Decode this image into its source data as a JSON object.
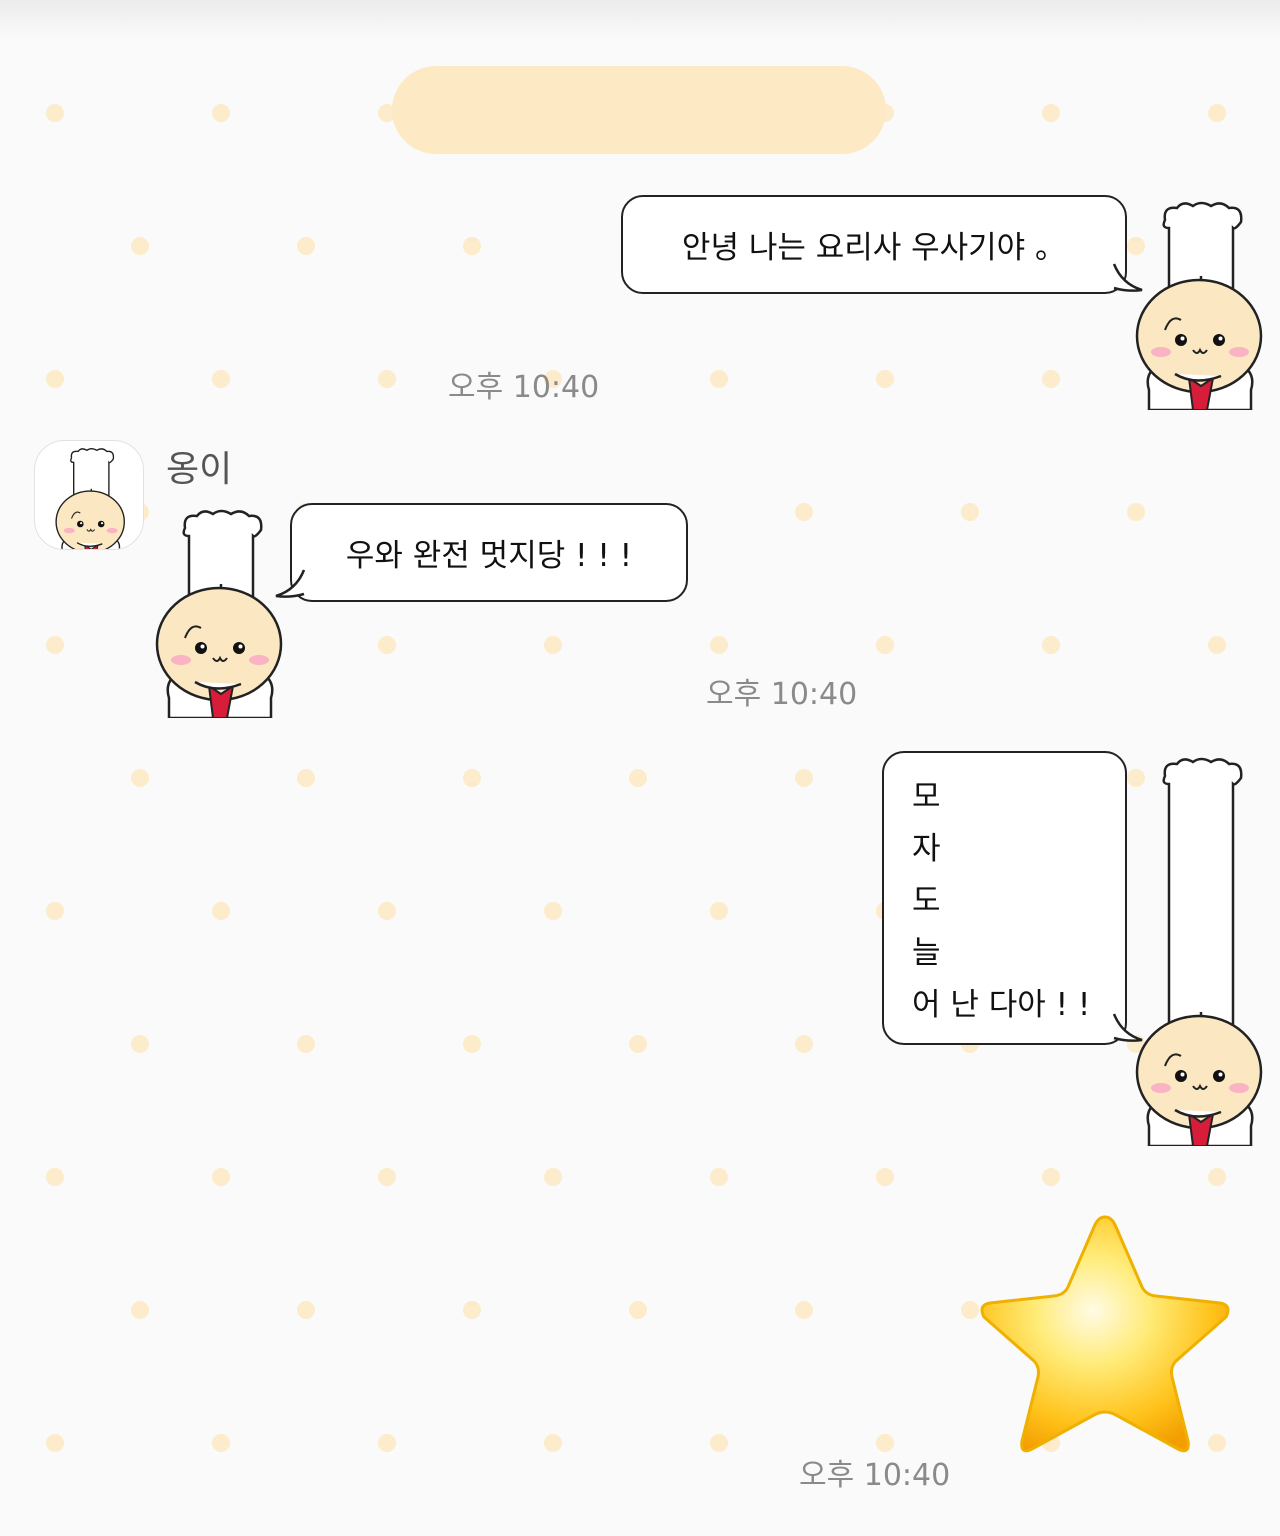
{
  "colors": {
    "background": "#fafafa",
    "dot": "#fdeccb",
    "date_pill": "#fde9c4",
    "bubble_border": "#222222",
    "timestamp": "#8a8a8a",
    "star_gold": "#f7b500"
  },
  "messages": [
    {
      "side": "outgoing",
      "text": "안녕 나는 요리사 우사기야 。",
      "time": "오후 10:40"
    },
    {
      "side": "incoming",
      "sender": "옹이",
      "text": "우와 완전 멋지당 ! ! !",
      "time": "오후 10:40"
    },
    {
      "side": "outgoing",
      "lines": [
        "모",
        "자",
        "도",
        "늘",
        "어 난 다아 ! !"
      ]
    },
    {
      "side": "outgoing",
      "emoji": "star-emoji",
      "time": "오후 10:40"
    }
  ],
  "icons": {
    "sticker": "chef-character-icon",
    "avatar": "chef-avatar-icon",
    "emoji": "star-icon"
  }
}
